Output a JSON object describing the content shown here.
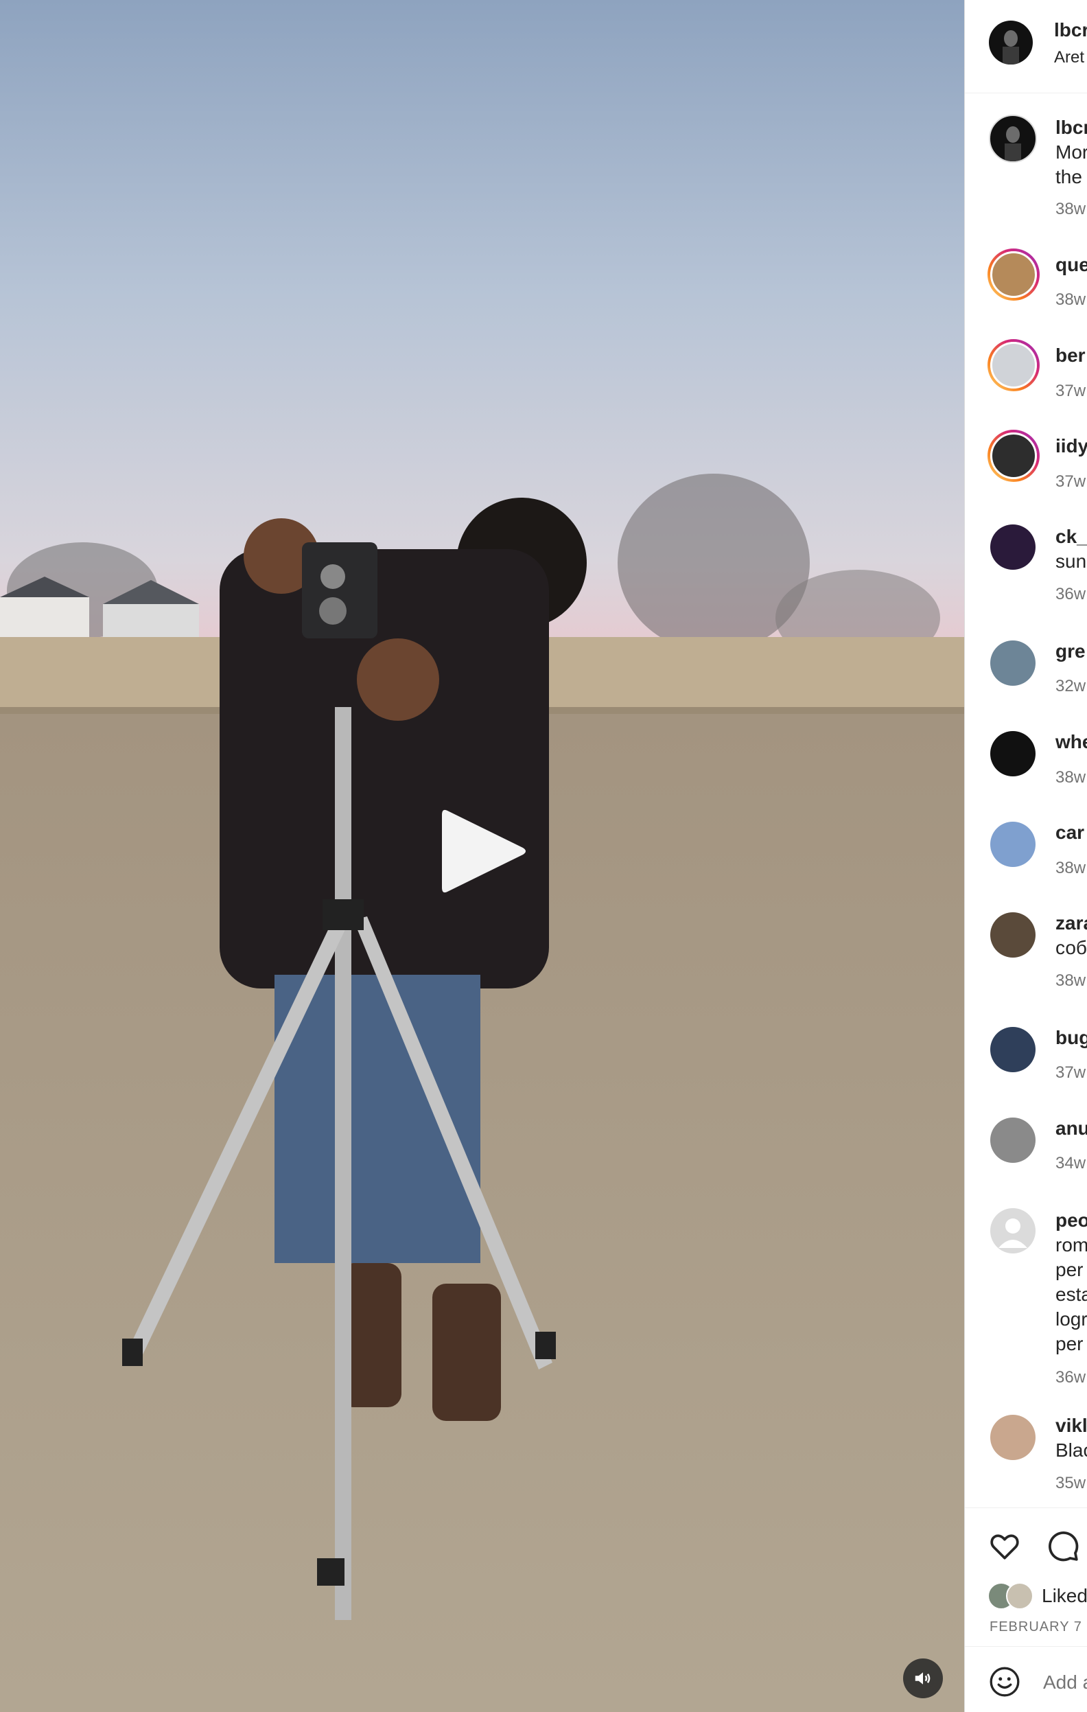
{
  "post": {
    "author_handle": "lbcr",
    "author_subtitle": "Aret",
    "caption_handle": "lbcr",
    "caption_lines": [
      "Mor",
      "the"
    ],
    "caption_time": "38w"
  },
  "comments": [
    {
      "handle": "que",
      "lines": [],
      "time": "38w",
      "ring": true
    },
    {
      "handle": "ber",
      "lines": [],
      "time": "37w",
      "ring": true
    },
    {
      "handle": "iidy",
      "lines": [],
      "time": "37w",
      "ring": true
    },
    {
      "handle": "ck_",
      "lines": [
        "sun"
      ],
      "time": "36w",
      "ring": false
    },
    {
      "handle": "gre",
      "lines": [],
      "time": "32w",
      "ring": false
    },
    {
      "handle": "whe",
      "lines": [],
      "time": "38w",
      "ring": false
    },
    {
      "handle": "car",
      "lines": [],
      "time": "38w",
      "ring": false
    },
    {
      "handle": "zara",
      "lines": [
        "соб"
      ],
      "time": "38w",
      "ring": false
    },
    {
      "handle": "bug",
      "lines": [],
      "time": "37w",
      "ring": false
    },
    {
      "handle": "anu",
      "lines": [],
      "time": "34w",
      "ring": false
    },
    {
      "handle": "peo",
      "lines": [
        "rom",
        "per",
        "esta",
        "logr",
        "per"
      ],
      "time": "36w",
      "ring": false
    },
    {
      "handle": "vikl",
      "lines": [
        "Blac"
      ],
      "time": "35w",
      "ring": false
    }
  ],
  "actions": {
    "liked_by_text": "Liked",
    "date": "FEBRUARY 7"
  },
  "add_comment": {
    "placeholder": "Add a"
  },
  "icons": {
    "play": "play-icon",
    "mute": "volume-icon",
    "like": "heart-icon",
    "comment": "comment-icon",
    "emoji": "emoji-icon"
  }
}
